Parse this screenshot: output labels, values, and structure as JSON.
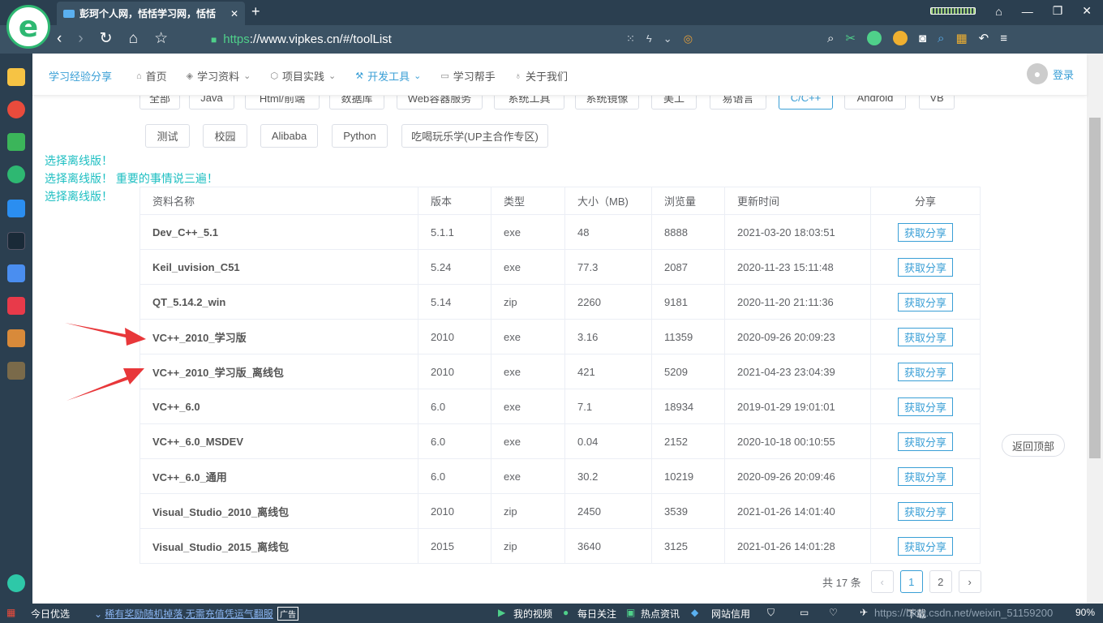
{
  "browser": {
    "tab_title": "彭珂个人网，恬恬学习网，恬恬",
    "url_https": "https",
    "url_rest": "://www.vipkes.cn/#/toolList"
  },
  "site": {
    "brand": "学习经验分享",
    "menu": [
      {
        "label": "首页"
      },
      {
        "label": "学习资料"
      },
      {
        "label": "项目实践"
      },
      {
        "label": "开发工具"
      },
      {
        "label": "学习帮手"
      },
      {
        "label": "关于我们"
      }
    ],
    "login": "登录"
  },
  "categories_row1": [
    "全部",
    "Java",
    "Html/前端",
    "数据库",
    "Web容器服务",
    "系统工具",
    "系统镜像",
    "美工",
    "易语言",
    "C/C++",
    "Android",
    "VB"
  ],
  "categories_row2": [
    "测试",
    "校园",
    "Alibaba",
    "Python",
    "吃喝玩乐学(UP主合作专区)"
  ],
  "notes": [
    "选择离线版！",
    "选择离线版！ 重要的事情说三遍！",
    "选择离线版！"
  ],
  "table": {
    "headers": [
      "资料名称",
      "版本",
      "类型",
      "大小（MB)",
      "浏览量",
      "更新时间",
      "分享"
    ],
    "share_label": "获取分享",
    "rows": [
      {
        "name": "Dev_C++_5.1",
        "version": "5.1.1",
        "type": "exe",
        "size": "48",
        "views": "8888",
        "time": "2021-03-20 18:03:51"
      },
      {
        "name": "Keil_uvision_C51",
        "version": "5.24",
        "type": "exe",
        "size": "77.3",
        "views": "2087",
        "time": "2020-11-23 15:11:48"
      },
      {
        "name": "QT_5.14.2_win",
        "version": "5.14",
        "type": "zip",
        "size": "2260",
        "views": "9181",
        "time": "2020-11-20 21:11:36"
      },
      {
        "name": "VC++_2010_学习版",
        "version": "2010",
        "type": "exe",
        "size": "3.16",
        "views": "11359",
        "time": "2020-09-26 20:09:23"
      },
      {
        "name": "VC++_2010_学习版_离线包",
        "version": "2010",
        "type": "exe",
        "size": "421",
        "views": "5209",
        "time": "2021-04-23 23:04:39"
      },
      {
        "name": "VC++_6.0",
        "version": "6.0",
        "type": "exe",
        "size": "7.1",
        "views": "18934",
        "time": "2019-01-29 19:01:01"
      },
      {
        "name": "VC++_6.0_MSDEV",
        "version": "6.0",
        "type": "exe",
        "size": "0.04",
        "views": "2152",
        "time": "2020-10-18 00:10:55"
      },
      {
        "name": "VC++_6.0_通用",
        "version": "6.0",
        "type": "exe",
        "size": "30.2",
        "views": "10219",
        "time": "2020-09-26 20:09:46"
      },
      {
        "name": "Visual_Studio_2010_离线包",
        "version": "2010",
        "type": "zip",
        "size": "2450",
        "views": "3539",
        "time": "2021-01-26 14:01:40"
      },
      {
        "name": "Visual_Studio_2015_离线包",
        "version": "2015",
        "type": "zip",
        "size": "3640",
        "views": "3125",
        "time": "2021-01-26 14:01:28"
      }
    ]
  },
  "pager": {
    "total": "共 17 条",
    "pages": [
      "1",
      "2"
    ]
  },
  "backtop": "返回顶部",
  "statusbar": {
    "left": "今日优选",
    "promo": "稀有奖励随机掉落,无需充值凭运气翻服",
    "ad": "广告",
    "items": [
      "我的视频",
      "每日关注",
      "热点资讯",
      "网站信用"
    ],
    "download": "下载",
    "watermark": "https://blog.csdn.net/weixin_51159200",
    "zoom": "90%"
  },
  "colors": {
    "accent": "#3a9fd6",
    "note": "#1ebfc2",
    "arrow": "#e8373a",
    "chrome": "#3b5264"
  }
}
